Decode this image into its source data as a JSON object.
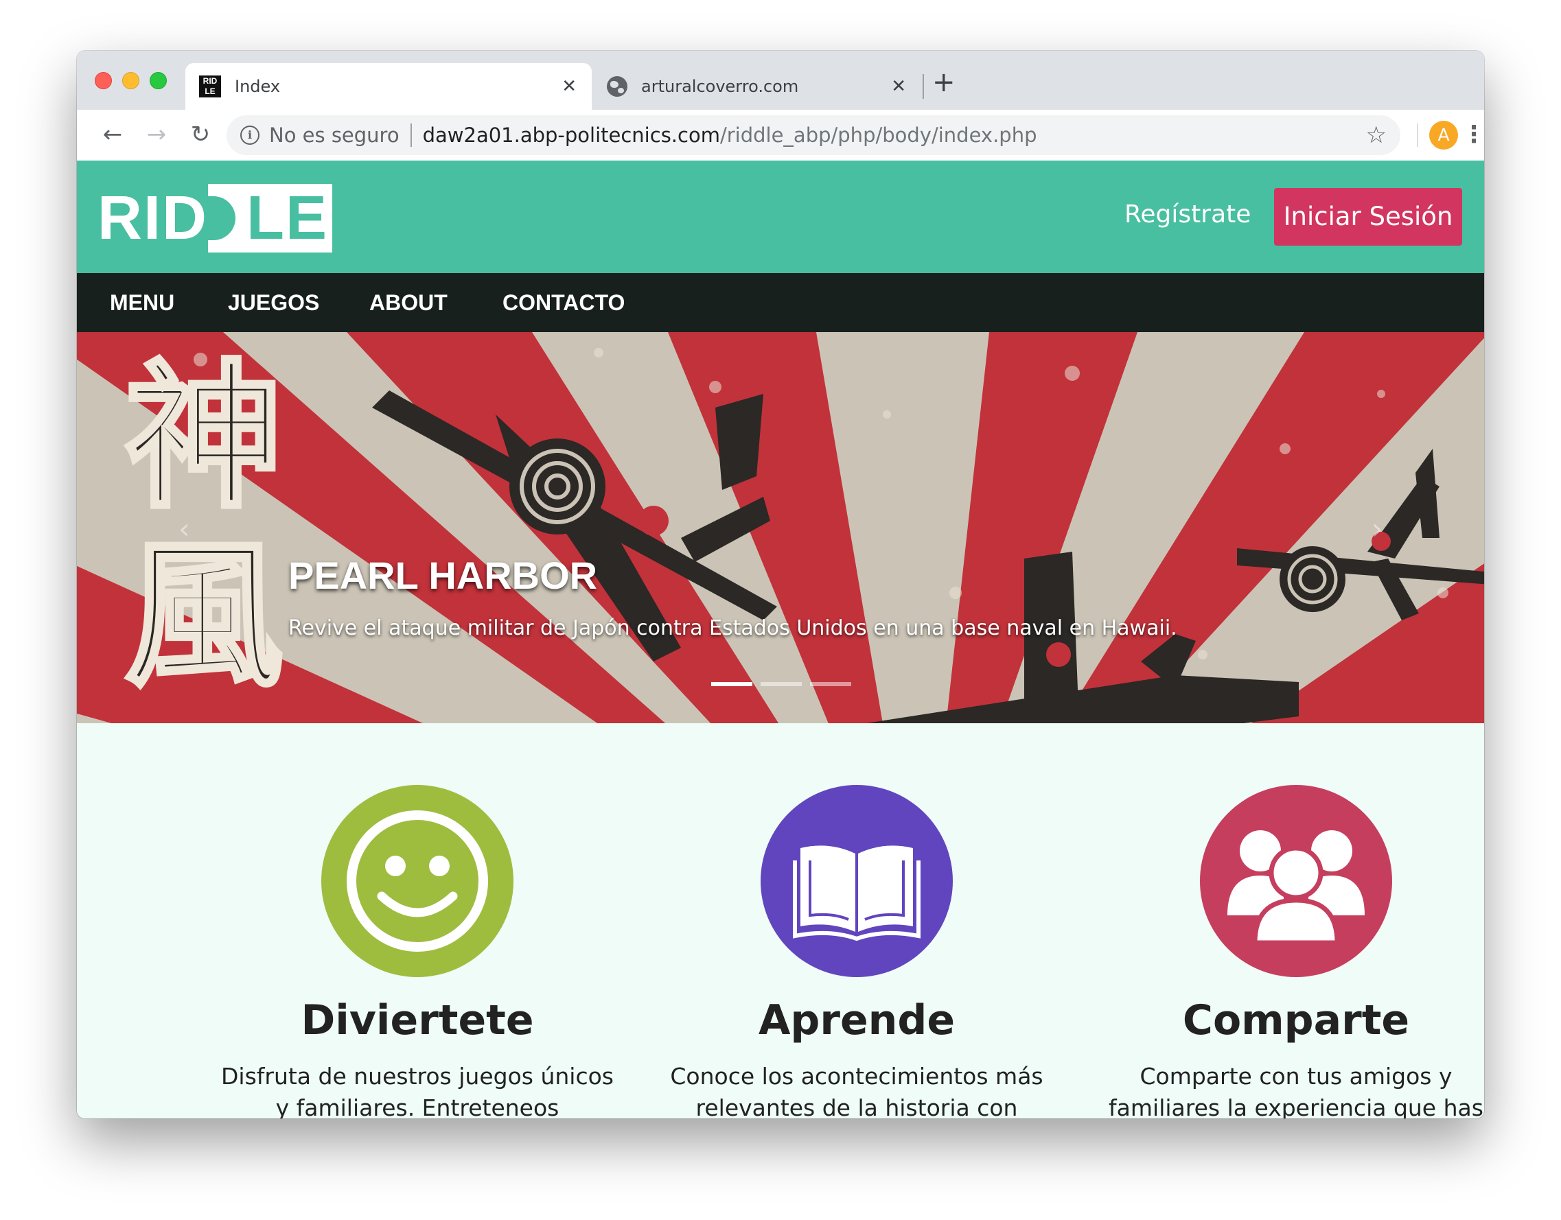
{
  "browser": {
    "tabs": [
      {
        "title": "Index",
        "favicon_text": "RID\nLE",
        "active": true
      },
      {
        "title": "arturalcoverro.com",
        "favicon": "globe-icon",
        "active": false
      }
    ],
    "tab_close_glyph": "✕",
    "new_tab_glyph": "+",
    "security_label": "No es seguro",
    "url_host": "daw2a01.abp-politecnics.com",
    "url_path": "/riddle_abp/php/body/index.php",
    "profile_initial": "A",
    "back_glyph": "←",
    "forward_glyph": "→",
    "reload_glyph": "↻",
    "star_glyph": "☆",
    "menu_glyph": "⋮",
    "info_glyph": "i"
  },
  "site": {
    "logo": {
      "left": "RID",
      "right": "LE"
    },
    "register_label": "Regístrate",
    "login_label": "Iniciar Sesión",
    "nav": [
      "MENU",
      "JUEGOS",
      "ABOUT",
      "CONTACTO"
    ],
    "colors": {
      "header": "#48bfa1",
      "nav": "#17201d",
      "login": "#d2355f",
      "page_bg": "#effcf8"
    }
  },
  "hero": {
    "kanji_top": "神",
    "kanji_bottom": "風",
    "title": "PEARL HARBOR",
    "caption": "Revive el ataque militar de Japón contra Estados Unidos en una base naval en Hawaii.",
    "prev_glyph": "‹",
    "next_glyph": "›",
    "slide_count": 3,
    "active_slide": 1
  },
  "features": [
    {
      "icon": "smiley-icon",
      "color": "#9ebd3f",
      "title": "Diviertete",
      "text": "Disfruta de nuestros juegos únicos y familiares. Entreteneos investigando"
    },
    {
      "icon": "open-book-icon",
      "color": "#6145be",
      "title": "Aprende",
      "text": "Conoce los acontecimientos más relevantes de la historia con nuestros"
    },
    {
      "icon": "group-icon",
      "color": "#c63e5e",
      "title": "Comparte",
      "text": "Comparte con tus amigos y familiares la experiencia que has tenido con"
    }
  ]
}
